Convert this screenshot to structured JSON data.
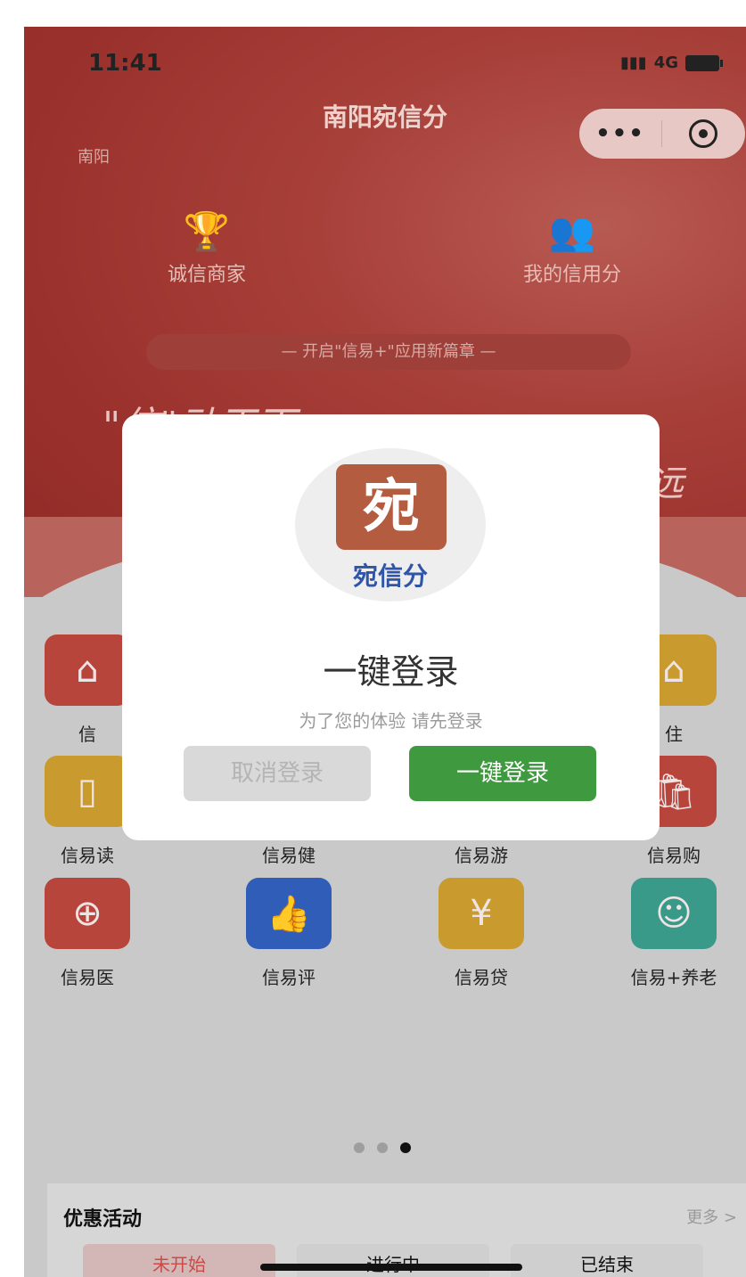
{
  "status_bar": {
    "time": "11:41",
    "network": "4G"
  },
  "header": {
    "title": "南阳宛信分",
    "city": "南阳",
    "capsule_more": "•••"
  },
  "quick_links": [
    {
      "label": "诚信商家",
      "icon": "trophy-icon"
    },
    {
      "label": "我的信用分",
      "icon": "users-icon"
    }
  ],
  "banner": {
    "text": "—   开启\"信易+\"应用新篇章   —"
  },
  "slogan": {
    "left": "\"信\"动天下",
    "right": "远"
  },
  "services_row1": [
    {
      "label": "信",
      "color": "#b8453c",
      "icon": "home-icon"
    },
    {
      "label": "住",
      "color": "#c99a2e",
      "icon": "home-icon"
    }
  ],
  "services_row2": [
    {
      "label": "信易读",
      "color": "#c99a2e",
      "icon": "book-icon"
    },
    {
      "label": "信易健",
      "color": "#3a6bbf",
      "icon": "fitness-icon"
    },
    {
      "label": "信易游",
      "color": "#3a9a8a",
      "icon": "travel-icon"
    },
    {
      "label": "信易购",
      "color": "#b8453c",
      "icon": "shopping-icon"
    }
  ],
  "services_row3": [
    {
      "label": "信易医",
      "color": "#b8453c",
      "icon": "medical-cross-icon"
    },
    {
      "label": "信易评",
      "color": "#2f5db8",
      "icon": "thumbs-up-icon"
    },
    {
      "label": "信易贷",
      "color": "#c99a2e",
      "icon": "loan-icon"
    },
    {
      "label": "信易+养老",
      "color": "#3a9a8a",
      "icon": "elderly-care-icon"
    }
  ],
  "promo": {
    "title": "优惠活动",
    "more": "更多 >",
    "tabs": [
      "未开始",
      "进行中",
      "已结束"
    ]
  },
  "modal": {
    "logo_mark": "宛",
    "logo_text": "宛信分",
    "title": "一键登录",
    "subtitle": "为了您的体验 请先登录",
    "cancel_label": "取消登录",
    "login_label": "一键登录"
  }
}
